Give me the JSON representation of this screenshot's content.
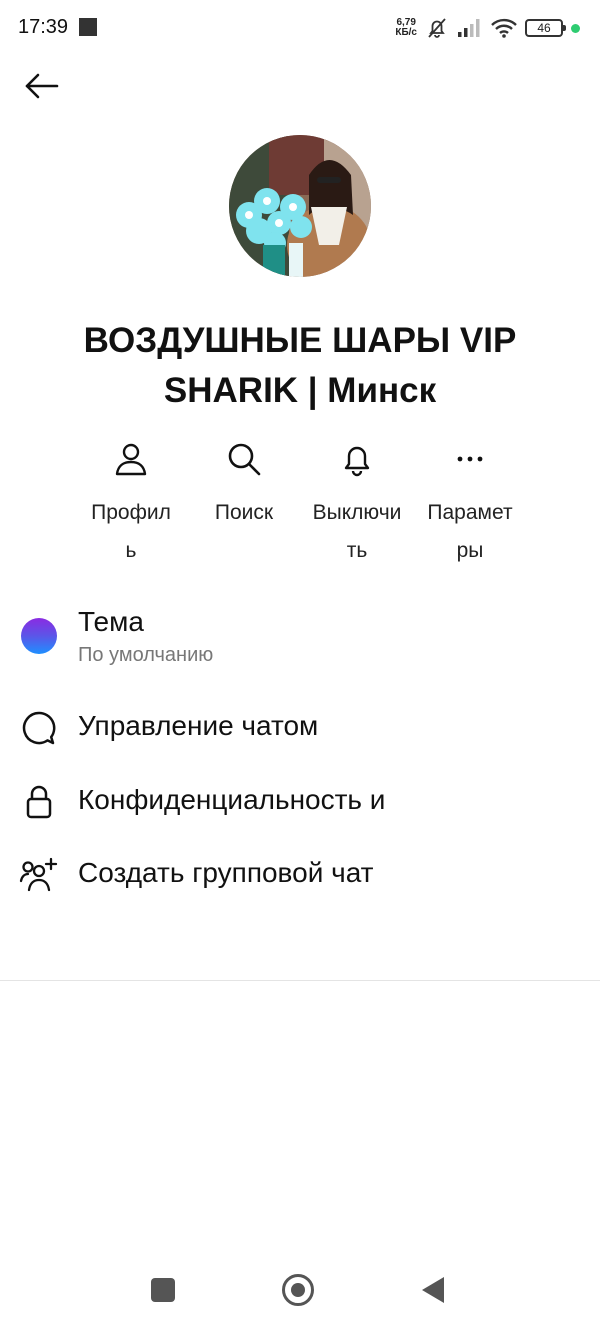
{
  "status_bar": {
    "time": "17:39",
    "net_speed_value": "6,79",
    "net_speed_unit": "КБ/с",
    "battery": "46"
  },
  "profile": {
    "title": "ВОЗДУШНЫЕ ШАРЫ VIP SHARIK | Минск"
  },
  "actions": [
    {
      "label": "Профиль",
      "icon": "person-icon"
    },
    {
      "label": "Поиск",
      "icon": "search-icon"
    },
    {
      "label": "Выключить",
      "icon": "bell-icon"
    },
    {
      "label": "Параметры",
      "icon": "more-icon"
    }
  ],
  "menu": {
    "theme_label": "Тема",
    "theme_value": "По умолчанию",
    "chat_management": "Управление чатом",
    "privacy": "Конфиденциальность и",
    "create_group": "Создать групповой чат"
  },
  "colors": {
    "accent_gradient_top": "#8a2be2",
    "accent_gradient_bottom": "#1e90ff"
  }
}
